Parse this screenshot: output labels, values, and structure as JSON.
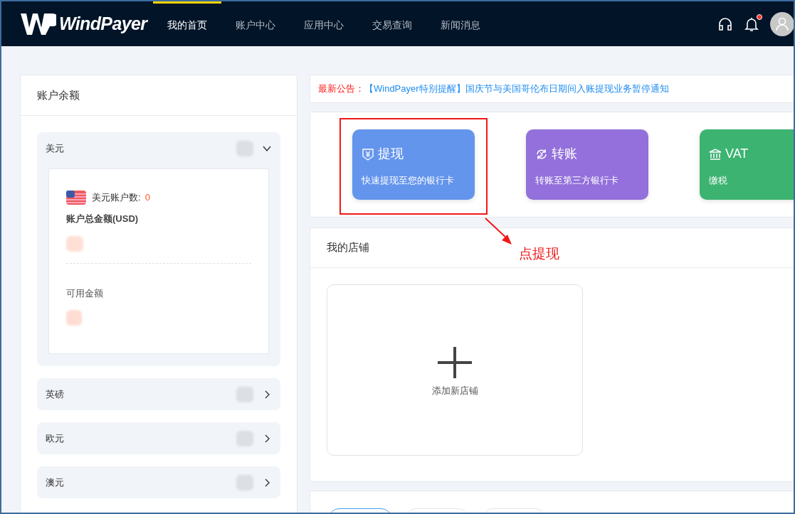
{
  "nav": {
    "logo": "WindPayer",
    "items": [
      {
        "label": "我的首页",
        "selected": true
      },
      {
        "label": "账户中心",
        "selected": false
      },
      {
        "label": "应用中心",
        "selected": false
      },
      {
        "label": "交易查询",
        "selected": false
      },
      {
        "label": "新闻消息",
        "selected": false
      }
    ],
    "has_unread": true
  },
  "balance": {
    "title": "账户余额",
    "currencies": [
      {
        "name": "美元",
        "expanded": true,
        "count_label": "美元账户数:",
        "count": "0",
        "total_label": "账户总金额(USD)",
        "available_label": "可用金额"
      },
      {
        "name": "英磅",
        "expanded": false
      },
      {
        "name": "欧元",
        "expanded": false
      },
      {
        "name": "澳元",
        "expanded": false
      }
    ]
  },
  "notice": {
    "label": "最新公告：",
    "text": "【WindPayer特别提醒】国庆节与美国哥伦布日期间入账提现业务暂停通知"
  },
  "actions": [
    {
      "kind": "withdraw",
      "title": "提现",
      "subtitle": "快速提现至您的银行卡",
      "color": "#6495ec"
    },
    {
      "kind": "transfer",
      "title": "转账",
      "subtitle": "转账至第三方银行卡",
      "color": "#9370db"
    },
    {
      "kind": "tax",
      "title": "VAT",
      "subtitle": "缴税",
      "color": "#3cb371"
    }
  ],
  "annotation": {
    "text": "点提现"
  },
  "shops": {
    "title": "我的店铺",
    "add_label": "添加新店铺"
  },
  "bottom_tabs": [
    {
      "selected": true
    },
    {
      "selected": false
    },
    {
      "selected": false
    }
  ]
}
